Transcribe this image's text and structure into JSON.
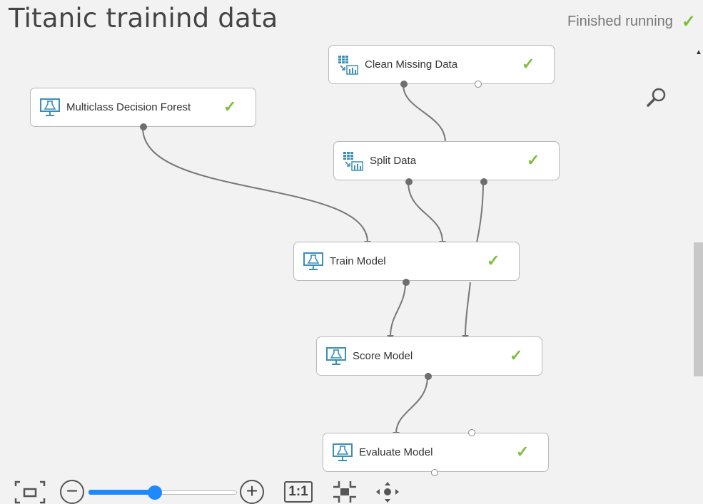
{
  "header": {
    "title": "Titanic trainind data",
    "status_text": "Finished running",
    "status_icon": "check-icon"
  },
  "nodes": [
    {
      "id": "clean",
      "label": "Clean Missing Data",
      "icon": "data-transform-icon",
      "status": "done"
    },
    {
      "id": "forest",
      "label": "Multiclass Decision Forest",
      "icon": "model-icon",
      "status": "done"
    },
    {
      "id": "split",
      "label": "Split Data",
      "icon": "data-transform-icon",
      "status": "done"
    },
    {
      "id": "train",
      "label": "Train Model",
      "icon": "model-icon",
      "status": "done"
    },
    {
      "id": "score",
      "label": "Score Model",
      "icon": "model-icon",
      "status": "done"
    },
    {
      "id": "evaluate",
      "label": "Evaluate Model",
      "icon": "model-icon",
      "status": "done"
    }
  ],
  "toolbar": {
    "zoom_level": 0.45,
    "one_to_one_label": "1:1",
    "fit_icon": "fit-to-screen-icon",
    "zoom_out_icon": "zoom-out-icon",
    "zoom_in_icon": "zoom-in-icon",
    "actual_size_icon": "actual-size-icon",
    "center_icon": "center-icon",
    "pan_icon": "pan-icon"
  },
  "colors": {
    "check": "#7cbf3a",
    "accent": "#1e88ff",
    "node_icon": "#3a8fb7",
    "connector": "#777777"
  }
}
